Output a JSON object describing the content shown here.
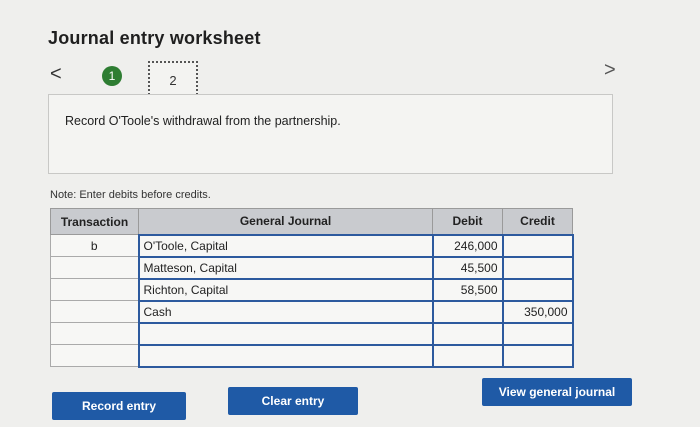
{
  "header": {
    "title": "Journal entry worksheet"
  },
  "nav": {
    "prev_symbol": "<",
    "next_symbol": ">",
    "steps": [
      "1",
      "2"
    ]
  },
  "prompt": "Record O'Toole's withdrawal from the partnership.",
  "note": "Note: Enter debits before credits.",
  "table": {
    "headers": {
      "transaction": "Transaction",
      "journal": "General Journal",
      "debit": "Debit",
      "credit": "Credit"
    },
    "rows": [
      {
        "transaction": "b",
        "account": "O'Toole, Capital",
        "debit": "246,000",
        "credit": ""
      },
      {
        "transaction": "",
        "account": "Matteson, Capital",
        "debit": "45,500",
        "credit": ""
      },
      {
        "transaction": "",
        "account": "Richton, Capital",
        "debit": "58,500",
        "credit": ""
      },
      {
        "transaction": "",
        "account": "Cash",
        "debit": "",
        "credit": "350,000"
      },
      {
        "transaction": "",
        "account": "",
        "debit": "",
        "credit": ""
      },
      {
        "transaction": "",
        "account": "",
        "debit": "",
        "credit": ""
      }
    ]
  },
  "buttons": {
    "record": "Record entry",
    "clear": "Clear entry",
    "view": "View general journal"
  },
  "colors": {
    "primary_button": "#1f5aa6",
    "step_active": "#2e7d32",
    "cell_border": "#2d5a9e",
    "header_bg": "#c9cbcf"
  }
}
